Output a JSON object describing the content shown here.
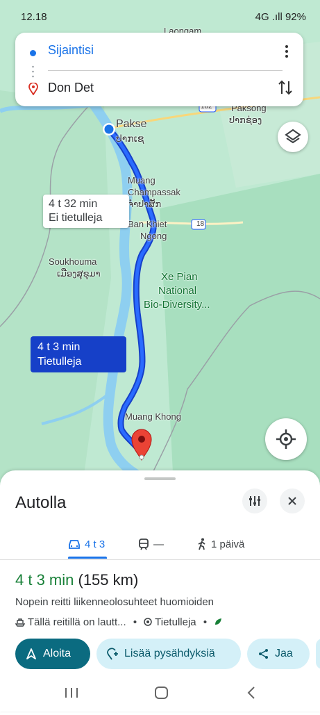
{
  "status_bar": {
    "time": "12.18",
    "right": "4G .ıll 92%"
  },
  "route_card": {
    "origin": "Sijaintisi",
    "destination": "Don Det"
  },
  "map": {
    "labels": {
      "pakse": "Pakse",
      "pakse_lao": "ປາກເຊ",
      "muang": "Muang",
      "champassak": "Champassak",
      "champassak_lao": "ຈຳປາສັກ",
      "ban_khiet": "Ban Khiet",
      "ngong": "Ngong",
      "souhkouma": "Soukhouma",
      "souhkouma_lao": "ເມືອງສຸຂຸມາ",
      "xe_pian_1": "Xe Pian",
      "xe_pian_2": "National",
      "xe_pian_3": "Bio-Diversity...",
      "muang_khong": "Muang Khong",
      "paksong": "Paksong",
      "paksong_lao": "ປາກຊ່ອງ",
      "laongam": "Laongam",
      "road_18": "18",
      "road_182": "182"
    },
    "alt_route_bubble": {
      "time": "4 t 32 min",
      "note": "Ei tietulleja"
    },
    "main_route_bubble": {
      "time": "4 t 3 min",
      "note": "Tietulleja"
    }
  },
  "sheet": {
    "title": "Autolla",
    "modes": {
      "car": "4 t 3",
      "transit": "—",
      "walk": "1 päivä"
    },
    "duration": "4 t 3 min",
    "distance": "(155 km)",
    "description": "Nopein reitti liikenneolosuhteet huomioiden",
    "info_ferry": "Tällä reitillä on lautt...",
    "info_tolls": "Tietulleja",
    "buttons": {
      "start": "Aloita",
      "add_stops": "Lisää pysähdyksiä",
      "share": "Jaa"
    }
  },
  "colors": {
    "route": "#1a56ff",
    "accent": "#1a73e8",
    "green": "#188038",
    "start_button": "#0b6b80"
  }
}
